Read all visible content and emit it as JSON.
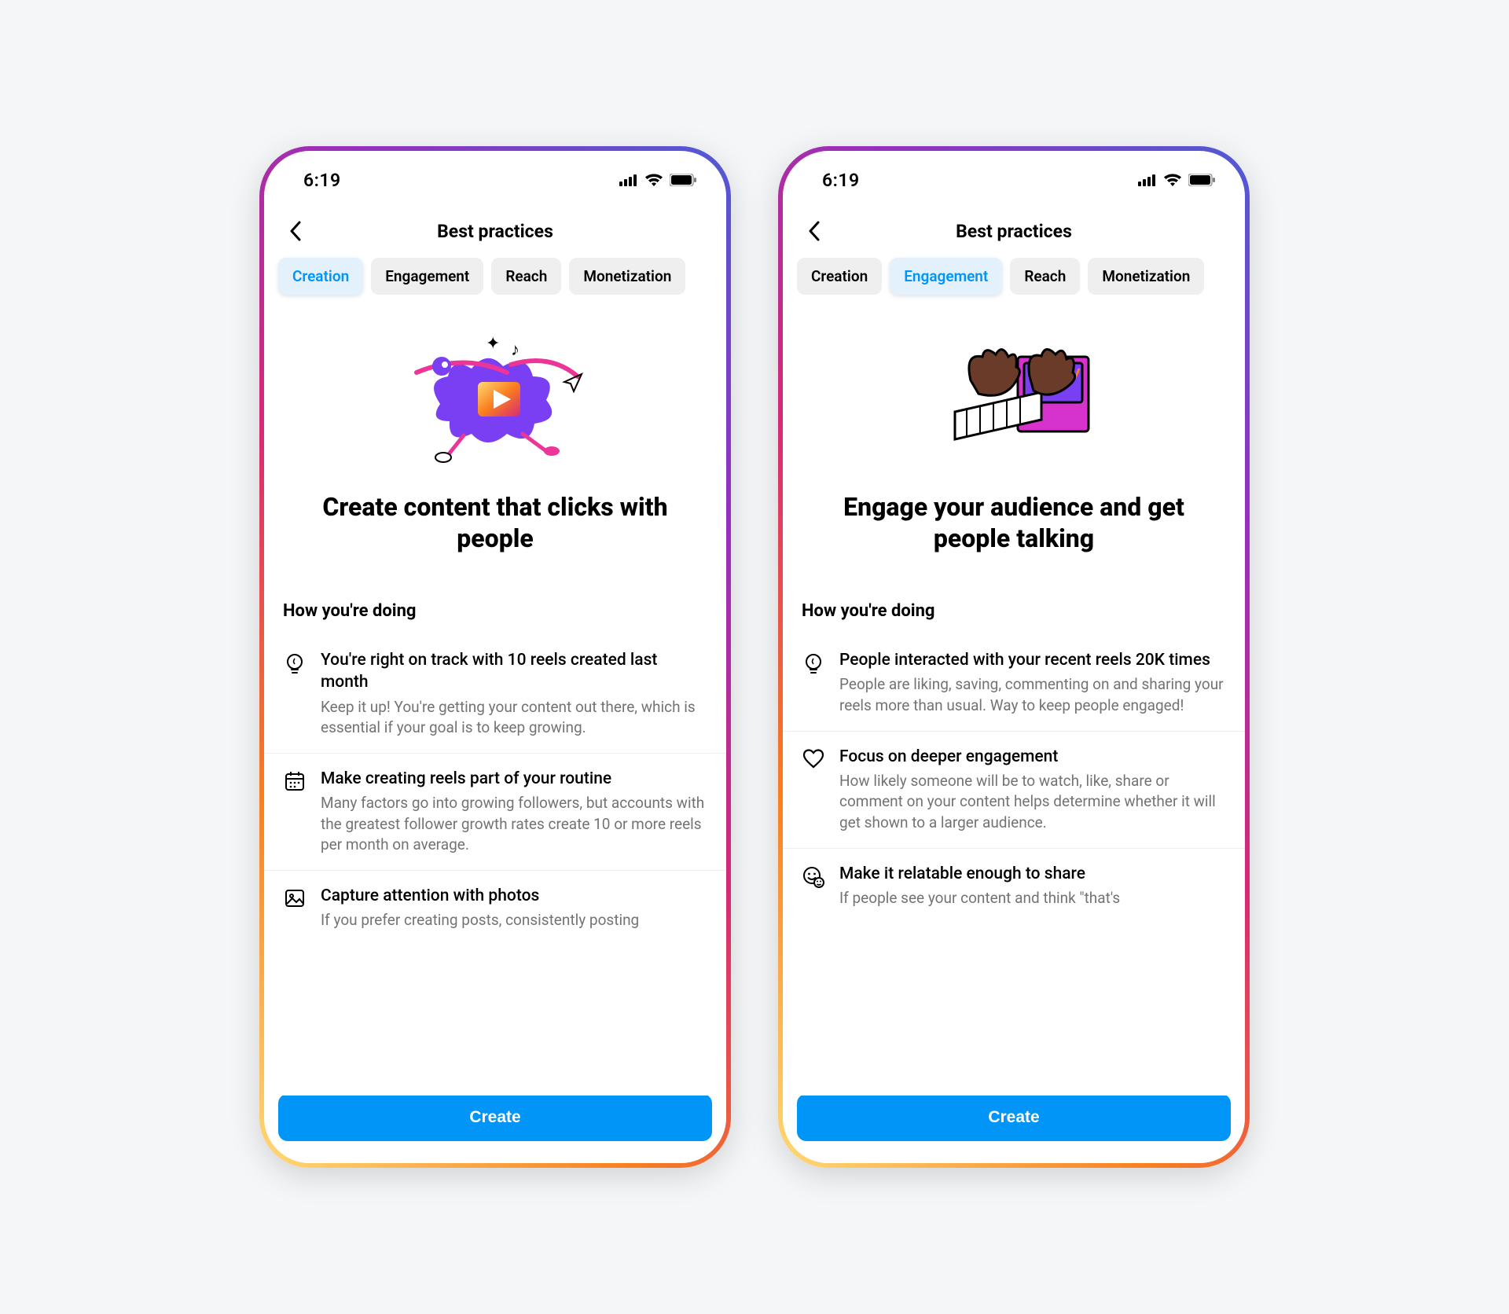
{
  "status": {
    "time": "6:19"
  },
  "header": {
    "title": "Best practices"
  },
  "tabs": [
    "Creation",
    "Engagement",
    "Reach",
    "Monetization"
  ],
  "cta": {
    "label": "Create"
  },
  "section_label": "How you're doing",
  "screens": [
    {
      "active_tab_index": 0,
      "hero_title": "Create content that clicks with people",
      "tips": [
        {
          "icon": "lightbulb-icon",
          "title": "You're right on track with 10 reels created last month",
          "desc": "Keep it up! You're getting your content out there, which is essential if your goal is to keep growing."
        },
        {
          "icon": "calendar-icon",
          "title": "Make creating reels part of your routine",
          "desc": "Many factors go into growing followers, but accounts with the greatest follower growth rates create 10 or more reels per month on average."
        },
        {
          "icon": "image-icon",
          "title": "Capture attention with photos",
          "desc": "If you prefer creating posts, consistently posting"
        }
      ]
    },
    {
      "active_tab_index": 1,
      "hero_title": "Engage your audience and get people talking",
      "tips": [
        {
          "icon": "lightbulb-icon",
          "title": "People interacted with your recent reels 20K times",
          "desc": "People are liking, saving, commenting on and sharing your reels more than usual. Way to keep people engaged!"
        },
        {
          "icon": "heart-icon",
          "title": "Focus on deeper engagement",
          "desc": "How likely someone will be to watch, like, share or comment on your content helps determine whether it will get shown to a larger audience."
        },
        {
          "icon": "smile-icon",
          "title": "Make it relatable enough to share",
          "desc": "If people see your content and think \"that's"
        }
      ]
    }
  ]
}
